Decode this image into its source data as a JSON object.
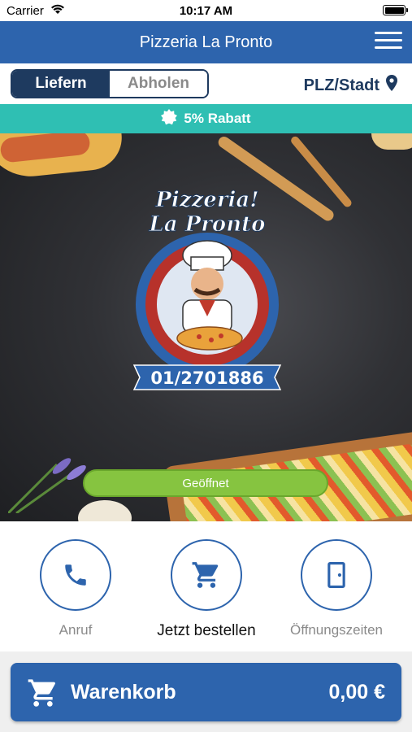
{
  "status": {
    "carrier": "Carrier",
    "time": "10:17 AM"
  },
  "header": {
    "title": "Pizzeria La Pronto",
    "menu_icon": "hamburger-menu-icon"
  },
  "mode": {
    "options": [
      "Liefern",
      "Abholen"
    ],
    "selected": "Liefern",
    "location_label": "PLZ/Stadt",
    "location_icon": "map-pin-icon"
  },
  "promo": {
    "text": "5% Rabatt",
    "icon": "badge-icon",
    "color": "#2fbfb3"
  },
  "hero": {
    "logo_line1": "Pizzeria!",
    "logo_line2": "La Pronto",
    "logo_phone": "01/2701886",
    "status_pill": "Geöffnet"
  },
  "actions": [
    {
      "label": "Anruf",
      "icon": "phone-icon"
    },
    {
      "label": "Jetzt bestellen",
      "icon": "cart-icon"
    },
    {
      "label": "Öffnungszeiten",
      "icon": "door-icon"
    }
  ],
  "cart": {
    "label": "Warenkorb",
    "amount": "0,00 €",
    "icon": "cart-icon"
  },
  "colors": {
    "primary": "#2d64ad",
    "dark": "#1e3a5f",
    "open": "#86c440"
  }
}
